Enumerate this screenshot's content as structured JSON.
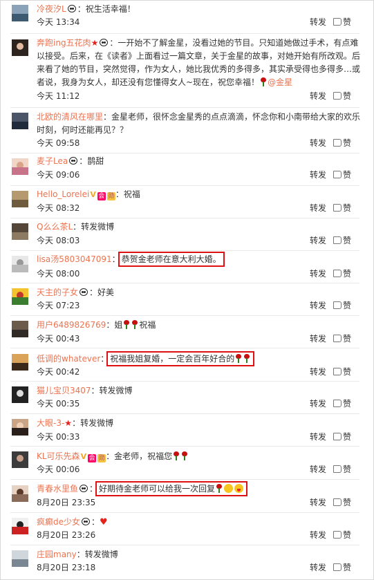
{
  "actions": {
    "repost_label": "转发",
    "like_label": "赞"
  },
  "accent_colors": {
    "username": "#eb7350",
    "highlight_box": "#d11111",
    "rose": "#c81010"
  },
  "comments": [
    {
      "user": "冷夜汐L",
      "text": "：祝生活幸福！",
      "time": "今天 13:34"
    },
    {
      "user": "奔跑ing五花肉",
      "text_lines": [
        "：一开始不了解金星，没看过她的节目。只知道她做过手术，有点难",
        "以接受。后来，在《读者》上面看过一篇文章，关于金星的故事，对她开始有所改观。后",
        "来看了她的节目，突然觉得，作为女人，她比我优秀的多得多，其实承受得也多得多…或",
        "者说，我身为女人，却还没有您懂得女人~现在，祝您幸福！"
      ],
      "mention": "@金星",
      "time": "今天 11:12"
    },
    {
      "user": "北欧的清风在哪里",
      "text_lines": [
        "：金星老师，很怀念金星秀的点点滴滴，怀念你和小南带给大家的欢乐",
        "时刻，何时还能再见？？"
      ],
      "time": "今天 09:58"
    },
    {
      "user": "麦子Lea",
      "text": "：鹊甜",
      "time": "今天 09:06"
    },
    {
      "user": "Hello_Lorelei",
      "text": "：祝福",
      "time": "今天 08:32"
    },
    {
      "user": "Q么么茶L",
      "text": "：转发微博",
      "time": "今天 08:03"
    },
    {
      "user": "lisa汤5803047091",
      "sep": "：",
      "text": "恭贺金老师在意大利大婚。",
      "time": "今天 08:00"
    },
    {
      "user": "天主的子女",
      "text": "：好美",
      "time": "今天 07:23"
    },
    {
      "user": "用户6489826769",
      "text_a": "：姐",
      "text_b": "祝福",
      "time": "今天 00:43"
    },
    {
      "user": "低调的whatever",
      "sep": "：",
      "text": "祝福我姐复婚，一定会百年好合的",
      "time": "今天 00:42"
    },
    {
      "user": "猫儿宝贝3407",
      "text": "：转发微博",
      "time": "今天 00:35"
    },
    {
      "user": "大眼-3-",
      "text": "：转发微博",
      "time": "今天 00:33"
    },
    {
      "user": "KL可乐先森",
      "text": "：金老师，祝福您",
      "time": "今天 00:06"
    },
    {
      "user": "青春水里鱼",
      "sep": "：",
      "text": "好期待金老师可以给我一次回复",
      "time": "8月20日 23:35"
    },
    {
      "user": "疯癫de少女",
      "text": "：",
      "time": "8月20日 23:26"
    },
    {
      "user": "庄园many",
      "text": "：转发微博",
      "time": "8月20日 23:18"
    }
  ],
  "icons": [
    "panda-emoji-icon",
    "rose-emoji-icon",
    "heart-emoji-icon",
    "like-icon",
    "star-badge-icon",
    "v-badge-icon"
  ]
}
